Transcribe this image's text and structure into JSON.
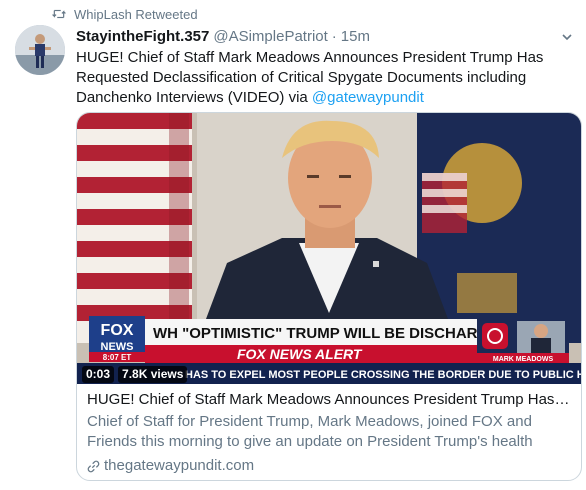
{
  "retweet": {
    "icon": "retweet-icon",
    "label": "WhipLash Retweeted"
  },
  "tweet": {
    "display_name": "StayintheFight.357",
    "handle": "@ASimplePatriot",
    "separator": "·",
    "timestamp": "15m",
    "text_part1": "HUGE! Chief of Staff Mark Meadows Announces President Trump Has Requested Declassification of Critical Spygate Documents including Danchenko Interviews (VIDEO) via ",
    "mention": "@gatewaypundit"
  },
  "card": {
    "video_time": "0:03",
    "views": "7.8K views",
    "chyron_headline": "WH \"OPTIMISTIC\" TRUMP WILL BE DISCHARGED TODAY",
    "chyron_alert": "FOX NEWS ALERT",
    "chyron_ticker": "HAS TO EXPEL MOST PEOPLE CROSSING THE BORDER DUE TO PUBLIC HEALTH CONSI",
    "fox_logo_top": "FOX",
    "fox_logo_bottom": "NEWS",
    "fox_time": "8:07 ET",
    "inset_name": "MARK MEADOWS",
    "title": "HUGE! Chief of Staff Mark Meadows Announces President Trump Has R...",
    "description": "Chief of Staff for President Trump, Mark Meadows, joined FOX and Friends this morning to give an update on President Trump's health and...",
    "domain": "thegatewaypundit.com",
    "link_icon": "link-icon"
  },
  "colors": {
    "accent": "#1da1f2",
    "secondary_text": "#657786",
    "border": "#ccd6dd",
    "fox_red": "#c8102e",
    "fox_blue": "#1e3f8a"
  }
}
